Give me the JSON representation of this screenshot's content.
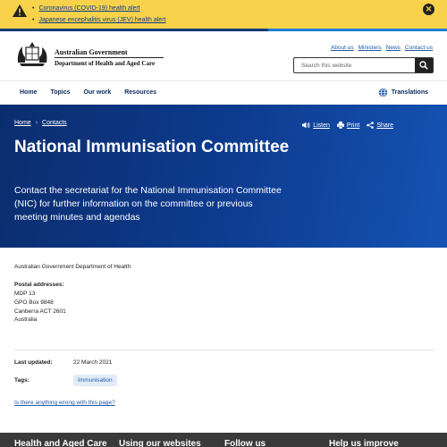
{
  "alert": {
    "items": [
      {
        "label": "Coronavirus (COVID-19) health alert"
      },
      {
        "label": "Japanese encephalitis virus (JEV) health alert"
      }
    ],
    "close_symbol": "✕",
    "icon": "warning-icon"
  },
  "header": {
    "gov_line1": "Australian Government",
    "gov_line2": "Department of Health and Aged Care",
    "top_links": [
      "About us",
      "Ministers",
      "News",
      "Contact us"
    ],
    "search_placeholder": "Search this website"
  },
  "nav": {
    "items": [
      "Home",
      "Topics",
      "Our work",
      "Resources"
    ],
    "translations": "Translations"
  },
  "hero": {
    "breadcrumb": [
      "Home",
      "Contacts"
    ],
    "breadcrumb_sep": "›",
    "actions": [
      "Listen",
      "Print",
      "Share"
    ],
    "title": "National Immunisation Committee",
    "description": "Contact the secretariat for the National Immunisation Committee (NIC) for further information on the committee or previous meeting minutes and agendas"
  },
  "content": {
    "organisation": "Australian Government Department of Health",
    "postal_label": "Postal addresses:",
    "postal_lines": [
      "MDP 13",
      "GPO Box 9848",
      "Canberra ACT 2601",
      "Australia"
    ],
    "last_updated_label": "Last updated:",
    "last_updated": "22 March 2021",
    "tags_label": "Tags:",
    "tag": "Immunisation",
    "feedback_link": "Is there anything wrong with this page?"
  },
  "footer": {
    "headings": [
      "Health and Aged Care",
      "Using our websites",
      "Follow us",
      "Help us improve"
    ]
  },
  "colors": {
    "alert_bg": "#f9d24b",
    "hero_bg": "#0d3b8e",
    "nav_text": "#0a2a5c",
    "link": "#1f5aa8",
    "footer_bg": "#3a3a3a"
  }
}
